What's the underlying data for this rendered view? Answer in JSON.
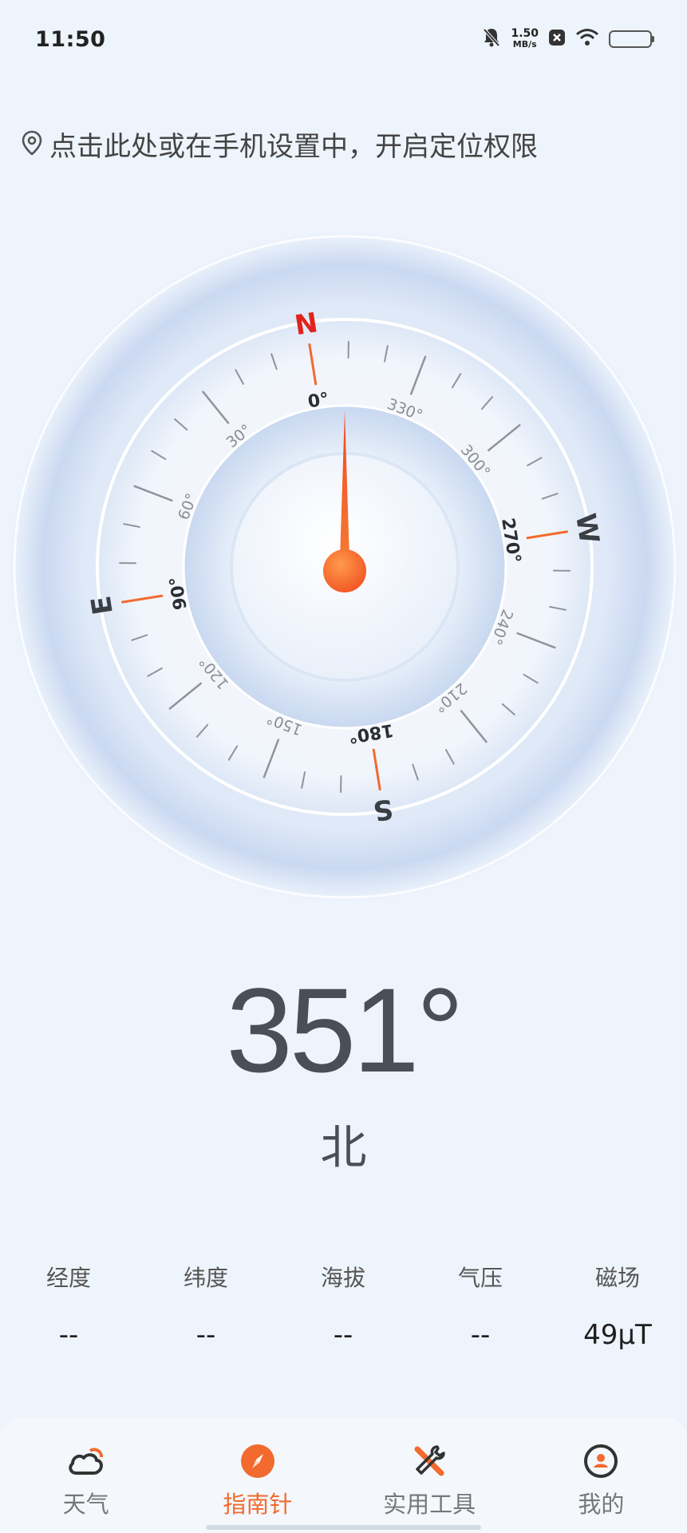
{
  "status_bar": {
    "time": "11:50",
    "net_speed_value": "1.50",
    "net_speed_unit": "MB/s",
    "icons": [
      "mute-bell-icon",
      "close-badge-icon",
      "wifi-icon",
      "battery-icon"
    ]
  },
  "location_banner": {
    "icon": "location-pin-icon",
    "text": "点击此处或在手机设置中，开启定位权限"
  },
  "compass": {
    "heading_deg": 351,
    "cardinals": [
      {
        "label": "N",
        "deg": 0
      },
      {
        "label": "E",
        "deg": 90
      },
      {
        "label": "S",
        "deg": 180
      },
      {
        "label": "W",
        "deg": 270
      }
    ],
    "degree_labels": [
      "0°",
      "30°",
      "60°",
      "90°",
      "120°",
      "150°",
      "180°",
      "210°",
      "240°",
      "270°",
      "300°",
      "330°"
    ],
    "needle_color": "#f25a28",
    "north_color": "#e0231c",
    "accent_tick_color": "#f26a2e"
  },
  "heading": {
    "value": "351°",
    "direction": "北"
  },
  "info": [
    {
      "label": "经度",
      "value": "--"
    },
    {
      "label": "纬度",
      "value": "--"
    },
    {
      "label": "海拔",
      "value": "--"
    },
    {
      "label": "气压",
      "value": "--"
    },
    {
      "label": "磁场",
      "value": "49μT"
    }
  ],
  "nav": {
    "active": "指南针",
    "items": [
      {
        "label": "天气",
        "icon": "cloud-sun-icon"
      },
      {
        "label": "指南针",
        "icon": "compass-icon"
      },
      {
        "label": "实用工具",
        "icon": "tools-icon"
      },
      {
        "label": "我的",
        "icon": "profile-icon"
      }
    ]
  },
  "colors": {
    "accent": "#f26a2e",
    "background": "#eef4fc",
    "text_primary": "#4a4f57"
  }
}
